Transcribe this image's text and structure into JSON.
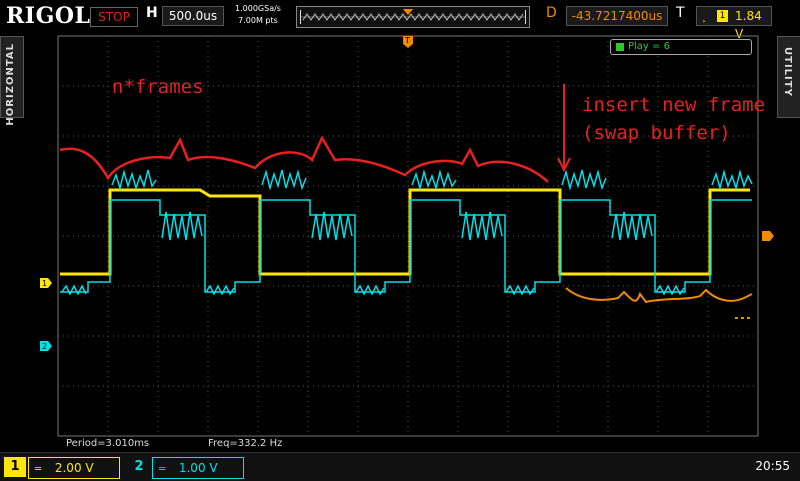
{
  "topbar": {
    "brand": "RIGOL",
    "run_state": "STOP",
    "timebase_label": "H",
    "timebase": "500.0us",
    "sample_rate": "1.000GSa/s",
    "memory_depth": "7.00M pts",
    "delay_label": "D",
    "delay": "-43.7217400us",
    "trigger_label": "T",
    "trigger_source": "1",
    "trigger_level": "1.84 V"
  },
  "side_tabs": {
    "left": "HORIZONTAL",
    "right": "UTILITY"
  },
  "play_indicator": "Play = 6",
  "measurements": {
    "period": "Period=3.010ms",
    "freq": "Freq=332.2 Hz"
  },
  "channels": [
    {
      "number": "1",
      "scale": "2.00 V",
      "color": "#ffe600"
    },
    {
      "number": "2",
      "scale": "1.00 V",
      "color": "#00e0e8"
    }
  ],
  "clock": "20:55",
  "annotations": {
    "left": "n*frames",
    "right_line1": "insert new frame",
    "right_line2": "(swap buffer)"
  },
  "markers": {
    "ch1": "1",
    "ch2": "2",
    "trigger": "T"
  },
  "colors": {
    "ch1": "#ffe600",
    "ch2": "#00e0e8",
    "annotation": "#e82020",
    "orange": "#f08a00",
    "grid": "#555555"
  }
}
